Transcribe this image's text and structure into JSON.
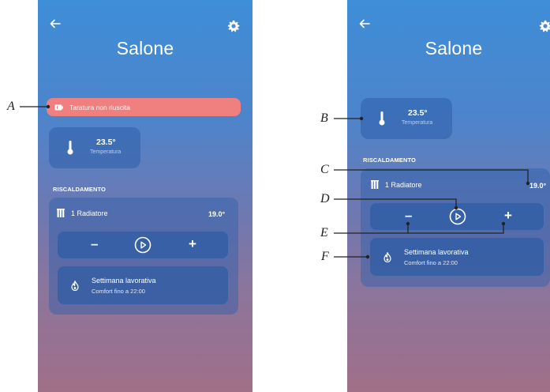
{
  "left_screen": {
    "room_title": "Salone",
    "alert_text": "Taratura non riuscita",
    "temperature": {
      "value": "23.5°",
      "label": "Temperatura"
    },
    "section_title": "RISCALDAMENTO",
    "radiator_label": "1 Radiatore",
    "setpoint": "19.0°",
    "minus": "–",
    "plus": "+",
    "schedule_title": "Settimana lavorativa",
    "schedule_subtitle": "Comfort fino a 22:00"
  },
  "right_screen": {
    "room_title": "Salone",
    "temperature": {
      "value": "23.5°",
      "label": "Temperatura"
    },
    "section_title": "RISCALDAMENTO",
    "radiator_label": "1 Radiatore",
    "setpoint": "19.0°",
    "minus": "–",
    "plus": "+",
    "schedule_title": "Settimana lavorativa",
    "schedule_subtitle": "Comfort fino a 22:00"
  },
  "callouts": {
    "a": "A",
    "b": "B",
    "c": "C",
    "d": "D",
    "e": "E",
    "f": "F"
  },
  "colors": {
    "alert_bg": "#f08080",
    "gradient_top": "#3e8ed8",
    "gradient_bottom": "#a06f88",
    "card_bg": "#2d5faa",
    "callout_line": "#222222"
  },
  "icons": [
    "back-arrow-icon",
    "gear-icon",
    "warning-battery-icon",
    "thermometer-icon",
    "radiator-icon",
    "play-circle-icon",
    "flame-icon"
  ]
}
